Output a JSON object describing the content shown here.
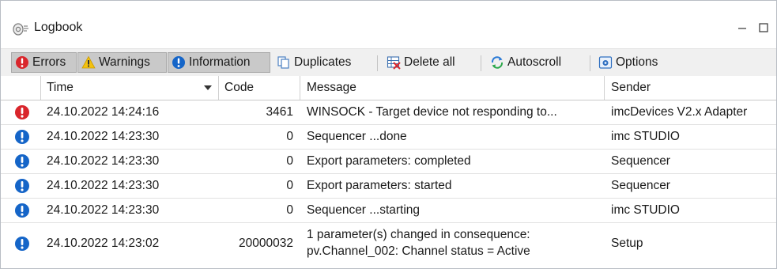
{
  "window": {
    "title": "Logbook",
    "icon": "logbook-icon"
  },
  "toolbar": {
    "errors_label": "Errors",
    "warnings_label": "Warnings",
    "information_label": "Information",
    "duplicates_label": "Duplicates",
    "delete_all_label": "Delete all",
    "autoscroll_label": "Autoscroll",
    "options_label": "Options",
    "toggled": [
      "Errors",
      "Warnings",
      "Information"
    ]
  },
  "table": {
    "columns": [
      "Time",
      "Code",
      "Message",
      "Sender"
    ],
    "sort_column": "Time",
    "rows": [
      {
        "severity": "error",
        "time": "24.10.2022 14:24:16",
        "code": "3461",
        "message": "WINSOCK - Target device not responding to...",
        "sender": "imcDevices V2.x Adapter"
      },
      {
        "severity": "info",
        "time": "24.10.2022 14:23:30",
        "code": "0",
        "message": "Sequencer ...done",
        "sender": "imc STUDIO"
      },
      {
        "severity": "info",
        "time": "24.10.2022 14:23:30",
        "code": "0",
        "message": "Export parameters: completed",
        "sender": "Sequencer"
      },
      {
        "severity": "info",
        "time": "24.10.2022 14:23:30",
        "code": "0",
        "message": "Export parameters: started",
        "sender": "Sequencer"
      },
      {
        "severity": "info",
        "time": "24.10.2022 14:23:30",
        "code": "0",
        "message": "Sequencer ...starting",
        "sender": "imc STUDIO"
      },
      {
        "severity": "info",
        "time": "24.10.2022 14:23:02",
        "code": "20000032",
        "message_line1": "1 parameter(s) changed in consequence:",
        "message_line2": "pv.Channel_002: Channel status = Active",
        "sender": "Setup"
      }
    ]
  },
  "colors": {
    "error": "#d9262c",
    "info": "#1565c8",
    "warning": "#f4c20d",
    "toolbar_bg": "#f0f0f0",
    "toggled_bg": "#c9c9c9"
  }
}
